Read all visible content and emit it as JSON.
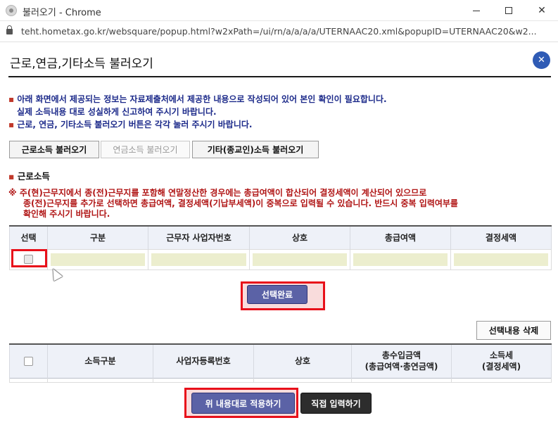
{
  "window": {
    "title": "불러오기 - Chrome",
    "url": "teht.hometax.go.kr/websquare/popup.html?w2xPath=/ui/rn/a/a/a/a/UTERNAAC20.xml&popupID=UTERNAAC20&w2..."
  },
  "popup": {
    "title": "근로,연금,기타소득 불러오기",
    "close_symbol": "✕"
  },
  "notices": {
    "line1": "아래 화면에서 제공되는 정보는 자료제출처에서 제공한 내용으로 작성되어 있어 본인 확인이 필요합니다.",
    "line2": "실제 소득내용 대로 성실하게 신고하여 주시기 바랍니다.",
    "line3": "근로, 연금, 기타소득 불러오기 버튼은 각각 눌러 주시기 바랍니다.",
    "bullet": "▪"
  },
  "tabs": {
    "earned": "근로소득 불러오기",
    "pension": "연금소득 불러오기",
    "other": "기타(종교인)소득 불러오기"
  },
  "section": {
    "title": "근로소득"
  },
  "warning": {
    "line1": "※ 주(현)근무지에서 종(전)근무지를 포함해 연말정산한 경우에는 총급여액이 합산되어 결정세액이 계산되어 있으므로",
    "line2": "종(전)근무지를 추가로 선택하면 총급여액, 결정세액(기납부세액)이 중복으로 입력될 수 있습니다. 반드시 중복 입력여부를",
    "line3": "확인해 주시기 바랍니다."
  },
  "table1": {
    "headers": [
      "선택",
      "구분",
      "근무자 사업자번호",
      "상호",
      "총급여액",
      "결정세액"
    ]
  },
  "buttons": {
    "select_done": "선택완료",
    "delete_selection": "선택내용 삭제",
    "apply": "위 내용대로 적용하기",
    "direct_input": "직접 입력하기"
  },
  "table2": {
    "headers": [
      "",
      "소득구분",
      "사업자등록번호",
      "상호"
    ],
    "header_total_line1": "총수입금액",
    "header_total_line2": "(총급여액·총연금액)",
    "header_tax_line1": "소득세",
    "header_tax_line2": "(결정세액)"
  },
  "colors": {
    "accent": "#2f5bb5",
    "primary_button": "#5b62a6",
    "highlight": "#e8101a",
    "notice_text": "#1c2a8a",
    "warning_text": "#b01515"
  }
}
